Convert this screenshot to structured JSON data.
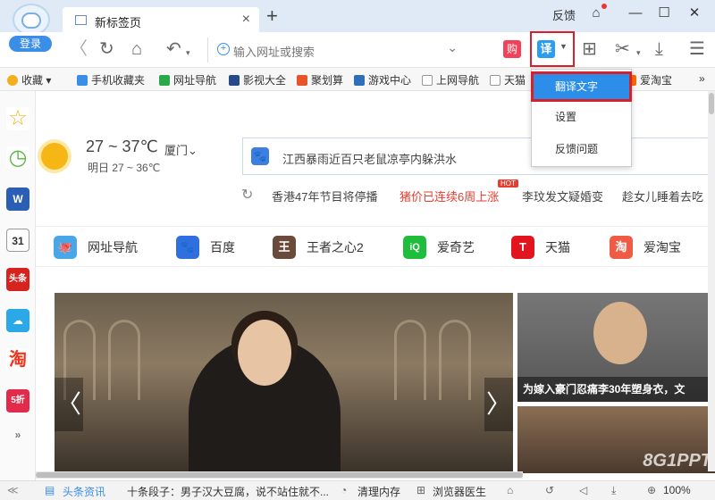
{
  "titlebar": {
    "login": "登录",
    "tab_title": "新标签页",
    "tab_close": "×",
    "new_tab": "+",
    "feedback": "反馈",
    "minimize": "—",
    "maximize": "☐",
    "close": "✕"
  },
  "navbar": {
    "back": "〈",
    "refresh": "↻",
    "home": "⌂",
    "undo": "↶",
    "address_placeholder": "输入网址或搜索",
    "address_dropdown": "⌄",
    "shop_label": "购",
    "translate_label": "译",
    "apps": "⊞",
    "cut": "✂",
    "download": "⤓",
    "menu": "☰"
  },
  "translate_menu": {
    "items": [
      "翻译文字",
      "设置",
      "反馈问题"
    ]
  },
  "bookmarks": {
    "items": [
      "收藏",
      "手机收藏夹",
      "网址导航",
      "影视大全",
      "聚划算",
      "游戏中心",
      "上网导航",
      "天猫",
      "爱淘宝"
    ],
    "more": "»"
  },
  "weather": {
    "temp": "27 ~ 37℃",
    "city": "厦门⌄",
    "tomorrow": "明日 27 ~ 36℃"
  },
  "search": {
    "hint": "江西暴雨近百只老鼠凉亭内躲洪水"
  },
  "news": {
    "items": [
      "香港47年节目将停播",
      "猪价已连续6周上涨",
      "李玟发文疑婚变",
      "趁女儿睡着去吃"
    ],
    "hot": "HOT"
  },
  "quicklinks": [
    {
      "label": "网址导航",
      "icon": "🐙",
      "color": "#49a7e8"
    },
    {
      "label": "百度",
      "icon": "🐾",
      "color": "#2f6fe0"
    },
    {
      "label": "王者之心2",
      "icon": "王",
      "color": "#6a4a3a"
    },
    {
      "label": "爱奇艺",
      "icon": "iQ",
      "color": "#1ebe3c"
    },
    {
      "label": "天猫",
      "icon": "T",
      "color": "#e2141e"
    },
    {
      "label": "爱淘宝",
      "icon": "淘",
      "color": "#ef5b45"
    }
  ],
  "hero": {
    "left_arrow": "〈",
    "right_arrow": "〉",
    "side_caption": "为嫁入豪门忍痛李30年塑身衣，文",
    "watermark": "8G1PPT"
  },
  "sidebar": {
    "items": [
      "☆",
      "◷",
      "W",
      "31",
      "头条",
      "☁",
      "淘",
      "5折",
      "»"
    ]
  },
  "statusbar": {
    "headline_label": "头条资讯",
    "headline_text": "十条段子：男子汉大豆腐，说不站住就不...",
    "clear_mem": "清理内存",
    "doctor": "浏览器医生",
    "zoom": "100%"
  }
}
